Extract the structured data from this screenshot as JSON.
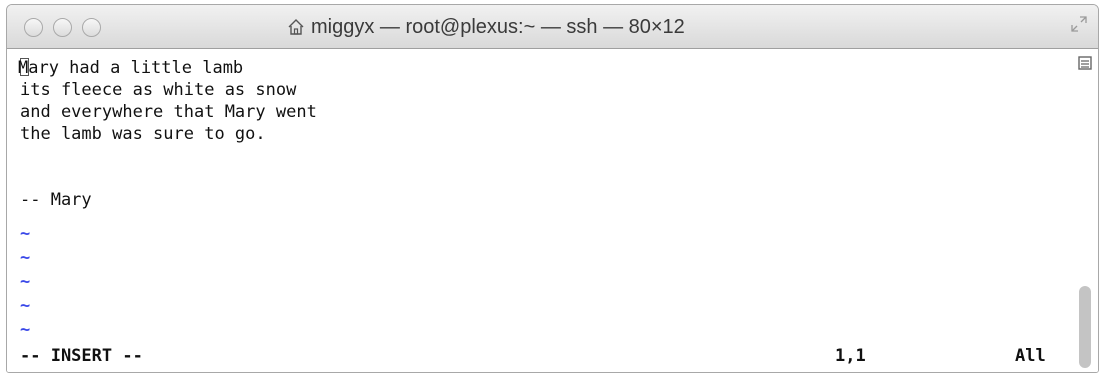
{
  "window": {
    "title": "miggyx — root@plexus:~ — ssh — 80×12"
  },
  "editor": {
    "lines": [
      "Mary had a little lamb",
      "its fleece as white as snow",
      "and everywhere that Mary went",
      "the lamb was sure to go.",
      "",
      "-- Mary"
    ],
    "empty_line_markers": [
      "~",
      "~",
      "~",
      "~",
      "~"
    ],
    "status": {
      "mode": "-- INSERT --",
      "position": "1,1",
      "scroll": "All"
    }
  },
  "icons": {
    "title_icon": "home-icon",
    "fullscreen": "fullscreen-icon",
    "split": "split-view-icon"
  },
  "colors": {
    "tilde": "#3a48e8",
    "text": "#111111",
    "titlebar_top": "#f1f1f1",
    "titlebar_bottom": "#d9d9d9",
    "scroll_thumb": "#c4c4c4"
  }
}
